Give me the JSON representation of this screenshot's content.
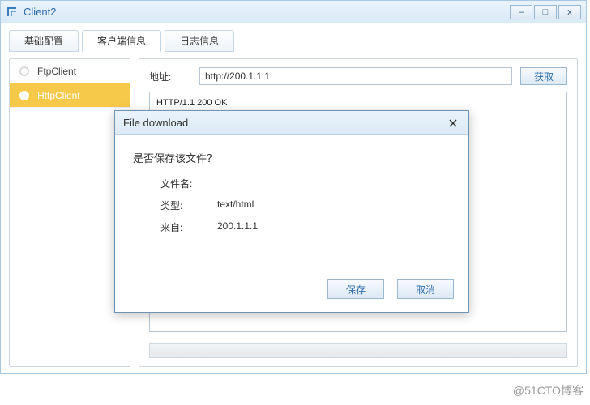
{
  "window": {
    "title": "Client2",
    "buttons": {
      "minimize": "–",
      "maximize": "□",
      "close": "x"
    }
  },
  "tabs": [
    {
      "label": "基础配置"
    },
    {
      "label": "客户端信息"
    },
    {
      "label": "日志信息"
    }
  ],
  "sidebar": {
    "items": [
      {
        "label": "FtpClient"
      },
      {
        "label": "HttpClient"
      }
    ]
  },
  "address": {
    "label": "地址:",
    "value": "http://200.1.1.1",
    "fetch_label": "获取"
  },
  "response_text": "HTTP/1.1 200 OK\nServer: ENSP HttpServer\nAuth: HUAWEI",
  "dialog": {
    "title": "File download",
    "prompt": "是否保存该文件？",
    "filename_label": "文件名:",
    "filename_value": "",
    "type_label": "类型:",
    "type_value": "text/html",
    "from_label": "来自:",
    "from_value": "200.1.1.1",
    "save_label": "保存",
    "cancel_label": "取消"
  },
  "watermark": "@51CTO博客"
}
